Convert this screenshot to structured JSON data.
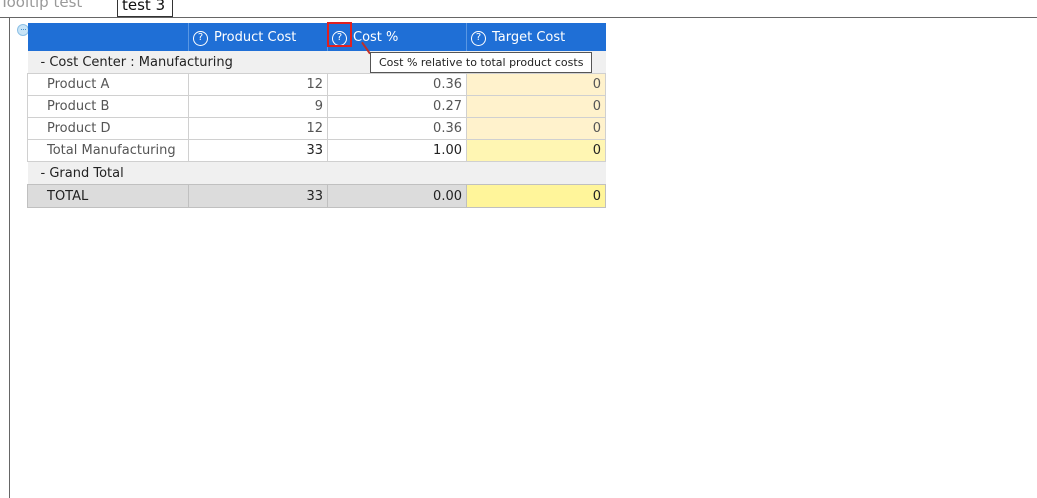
{
  "tabs": {
    "plain_label": "Tooltip test",
    "active_label": "test 3"
  },
  "grid": {
    "columns": [
      {
        "label": ""
      },
      {
        "label": "Product Cost",
        "icon": "question-circle-icon"
      },
      {
        "label": "Cost %",
        "icon": "question-circle-icon"
      },
      {
        "label": "Target Cost",
        "icon": "question-circle-icon"
      }
    ],
    "groups": [
      {
        "label": "-  Cost Center : Manufacturing",
        "rows": [
          {
            "label": "Product A",
            "product_cost": "12",
            "cost_pct": "0.36",
            "target_cost": "0"
          },
          {
            "label": "Product B",
            "product_cost": "9",
            "cost_pct": "0.27",
            "target_cost": "0"
          },
          {
            "label": "Product D",
            "product_cost": "12",
            "cost_pct": "0.36",
            "target_cost": "0"
          }
        ],
        "total": {
          "label": "Total Manufacturing",
          "product_cost": "33",
          "cost_pct": "1.00",
          "target_cost": "0"
        }
      },
      {
        "label": "-  Grand Total",
        "total": {
          "label": "TOTAL",
          "product_cost": "33",
          "cost_pct": "0.00",
          "target_cost": "0"
        }
      }
    ]
  },
  "tooltip": {
    "text": "Cost % relative to total product costs"
  },
  "colors": {
    "header_bg": "#1f6fd6",
    "target_cell_bg": "#fff2cc",
    "highlight": "#e02020"
  }
}
